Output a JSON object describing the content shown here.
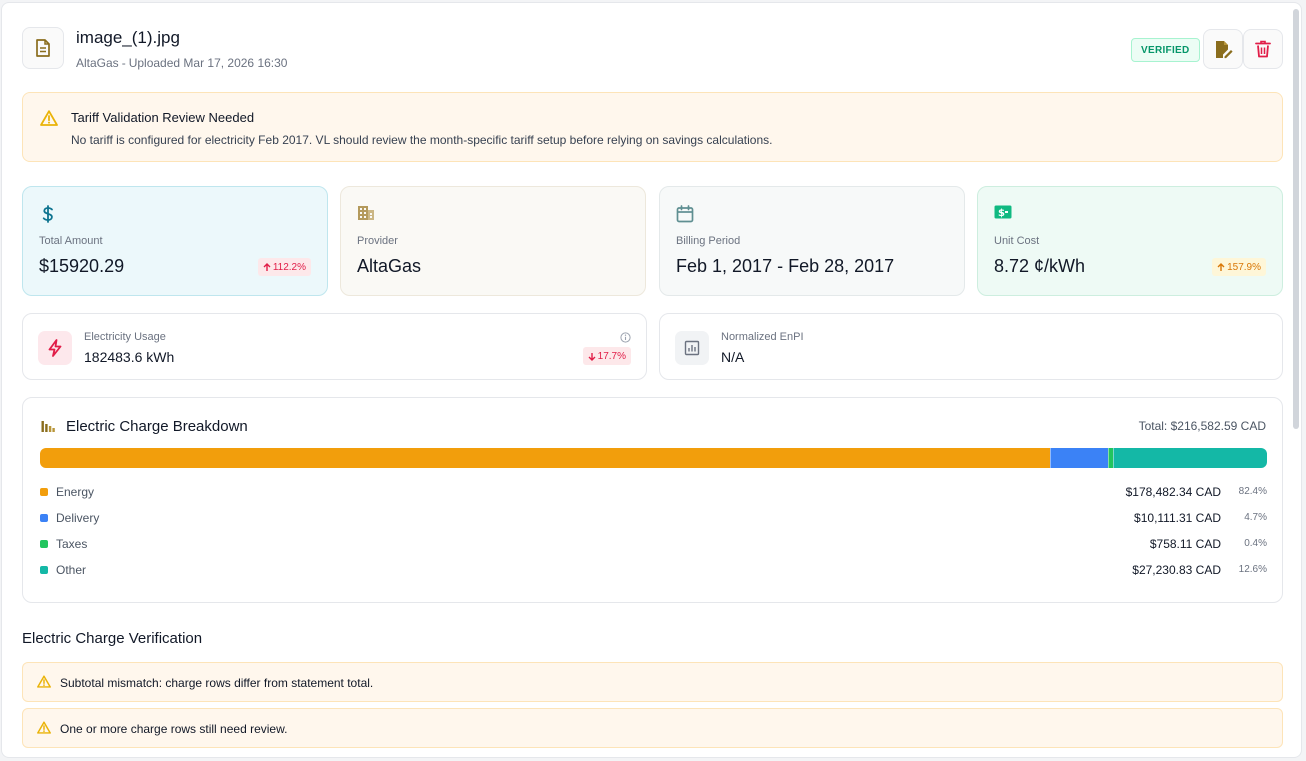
{
  "header": {
    "file_name": "image_(1).jpg",
    "provider": "AltaGas",
    "separator": "-",
    "uploaded_text": "Uploaded Mar 17, 2026 16:30",
    "status_badge": "VERIFIED"
  },
  "alert": {
    "title": "Tariff Validation Review Needed",
    "message": "No tariff is configured for electricity Feb 2017. VL should review the month-specific tariff setup before relying on savings calculations."
  },
  "stats": {
    "total_amount": {
      "label": "Total Amount",
      "value": "$15920.29",
      "delta": "112.2%",
      "delta_direction": "up"
    },
    "provider": {
      "label": "Provider",
      "value": "AltaGas"
    },
    "billing_period": {
      "label": "Billing Period",
      "value": "Feb 1, 2017 - Feb 28, 2017"
    },
    "unit_cost": {
      "label": "Unit Cost",
      "value": "8.72 ¢/kWh",
      "delta": "157.9%",
      "delta_direction": "up"
    }
  },
  "metrics": {
    "electricity_usage": {
      "label": "Electricity Usage",
      "value": "182483.6 kWh",
      "delta": "17.7%",
      "delta_direction": "down"
    },
    "normalized_enpi": {
      "label": "Normalized EnPI",
      "value": "N/A"
    }
  },
  "breakdown": {
    "title": "Electric Charge Breakdown",
    "total": "Total: $216,582.59 CAD",
    "items": [
      {
        "name": "Energy",
        "amount": "$178,482.34 CAD",
        "percent": "82.4%",
        "share": 82.4,
        "color": "#f29e0c"
      },
      {
        "name": "Delivery",
        "amount": "$10,111.31 CAD",
        "percent": "4.7%",
        "share": 4.7,
        "color": "#3b82f6"
      },
      {
        "name": "Taxes",
        "amount": "$758.11 CAD",
        "percent": "0.4%",
        "share": 0.4,
        "color": "#22c55e"
      },
      {
        "name": "Other",
        "amount": "$27,230.83 CAD",
        "percent": "12.6%",
        "share": 12.6,
        "color": "#14b8a6"
      }
    ]
  },
  "verification": {
    "title": "Electric Charge Verification",
    "items": [
      {
        "text": "Subtotal mismatch: charge rows differ from statement total."
      },
      {
        "text": "One or more charge rows still need review."
      }
    ]
  },
  "colors": {
    "accent_gold": "#8a6d1d",
    "danger": "#e11d48",
    "success": "#059669",
    "warning": "#eab308"
  },
  "icons": {
    "file": "document-icon",
    "edit": "edit-document-icon",
    "delete": "trash-icon",
    "alert": "warning-triangle-icon",
    "total": "dollar-icon",
    "provider": "building-icon",
    "period": "calendar-icon",
    "unit": "money-bill-icon",
    "usage": "lightning-icon",
    "enpi": "chart-icon",
    "info": "info-icon",
    "breakdown": "bar-chart-icon"
  }
}
